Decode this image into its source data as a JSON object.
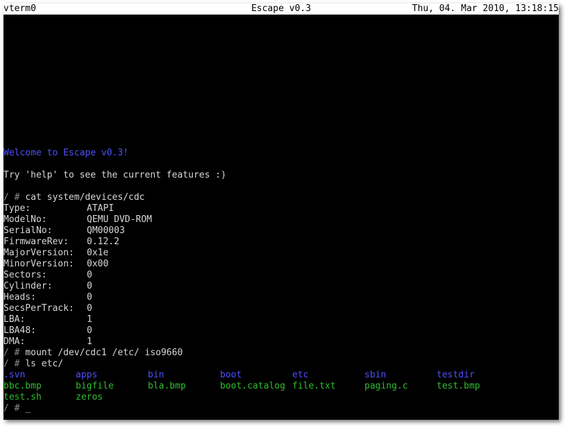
{
  "titlebar": {
    "left": "vterm0",
    "center": "Escape v0.3",
    "right": "Thu, 04. Mar 2010, 13:18:15"
  },
  "welcome": "Welcome to Escape v0.3!",
  "help": "Try 'help' to see the current features :)",
  "prompt": "/ #",
  "cmd_cat": "cat system/devices/cdc",
  "device_info": [
    {
      "key": "Type:",
      "value": "ATAPI"
    },
    {
      "key": "ModelNo:",
      "value": "QEMU DVD-ROM"
    },
    {
      "key": "SerialNo:",
      "value": "QM00003"
    },
    {
      "key": "FirmwareRev:",
      "value": "0.12.2"
    },
    {
      "key": "MajorVersion:",
      "value": "0x1e"
    },
    {
      "key": "MinorVersion:",
      "value": "0x00"
    },
    {
      "key": "Sectors:",
      "value": "0"
    },
    {
      "key": "Cylinder:",
      "value": "0"
    },
    {
      "key": "Heads:",
      "value": "0"
    },
    {
      "key": "SecsPerTrack:",
      "value": "0"
    },
    {
      "key": "LBA:",
      "value": "1"
    },
    {
      "key": "LBA48:",
      "value": "0"
    },
    {
      "key": "DMA:",
      "value": "1"
    }
  ],
  "cmd_mount": "mount /dev/cdc1 /etc/ iso9660",
  "cmd_ls": "ls etc/",
  "ls_rows": [
    [
      ".svn",
      "apps",
      "bin",
      "boot",
      "etc",
      "sbin",
      "testdir"
    ],
    [
      "bbc.bmp",
      "bigfile",
      "bla.bmp",
      "boot.catalog",
      "file.txt",
      "paging.c",
      "test.bmp"
    ],
    [
      "test.sh",
      "zeros"
    ]
  ],
  "colors": {
    "directory": "#4f4fff",
    "file": "#2fbf2f",
    "prompt": "#8a8a8a",
    "text": "#d8d8d8",
    "titlebar_bg": "#ffffff",
    "screen_bg": "#000000"
  },
  "cursor": "_"
}
